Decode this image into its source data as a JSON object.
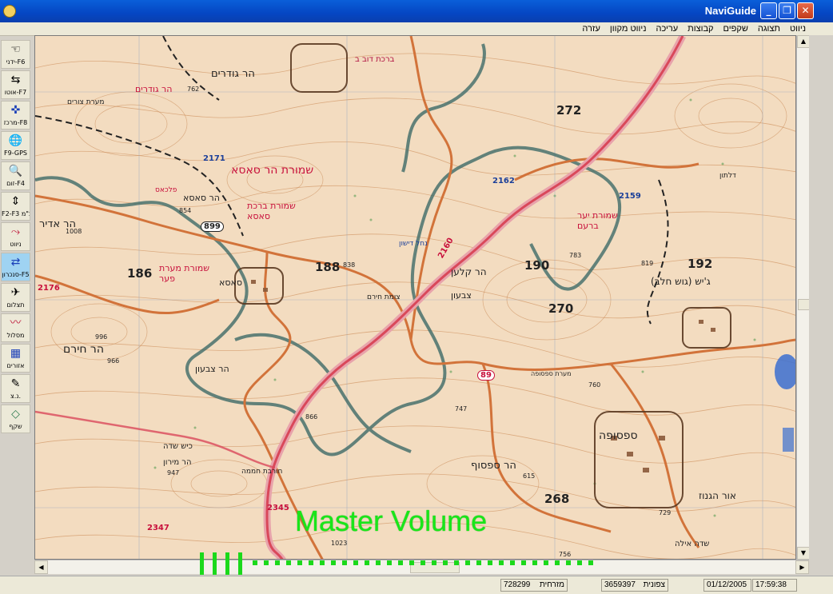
{
  "window": {
    "title": "NaviGuide",
    "minimize": "_",
    "maximize": "❐",
    "close": "✕"
  },
  "menu": [
    "ניווט",
    "תצוגה",
    "שקפים",
    "קבוצות",
    "עריכה",
    "ניווט מקוון",
    "עזרה"
  ],
  "toolbar": [
    {
      "label": "ידני-F6",
      "icon": "hand-pointer-icon",
      "glyph": "☜"
    },
    {
      "label": "אוטו-F7",
      "icon": "auto-navigate-icon",
      "glyph": "⇆"
    },
    {
      "label": "מרכז-F8",
      "icon": "center-crosshair-icon",
      "glyph": "✜"
    },
    {
      "label": "F9-GPS",
      "icon": "globe-icon",
      "glyph": "🌐"
    },
    {
      "label": "זום-F4",
      "icon": "zoom-magnifier-icon",
      "glyph": "🔍"
    },
    {
      "label": "F2-F3 קנ\"מ",
      "icon": "scale-icon",
      "glyph": "⇕"
    },
    {
      "label": "ניווט",
      "icon": "route-icon",
      "glyph": "⤳"
    },
    {
      "label": "סנכרון-F5",
      "icon": "sync-icon",
      "glyph": "⇄"
    },
    {
      "label": "תצלום",
      "icon": "aerial-photo-icon",
      "glyph": "✈"
    },
    {
      "label": "מסלול",
      "icon": "track-icon",
      "glyph": "〰"
    },
    {
      "label": "אזורים",
      "icon": "areas-icon",
      "glyph": "▦"
    },
    {
      "label": "נ.צ.",
      "icon": "coordinate-pin-icon",
      "glyph": "✎"
    },
    {
      "label": "שקף",
      "icon": "layer-icon",
      "glyph": "◇"
    }
  ],
  "map": {
    "labels": [
      "ברכת דוב ב",
      "הר גודרים",
      "הר גודרים",
      "מערת צורים",
      "שמורת הר סאסא",
      "פלכאס",
      "הר סאסא",
      "שמורת ברכת סאסא",
      "הר אדיר",
      "שמורת מערת פער",
      "סאסא",
      "צומת חירם",
      "הר קלען",
      "צבעון",
      "שמורת יער ברעם",
      "ג'יש (גוש חלב)",
      "הר חירם",
      "הר צבעון",
      "כיש שדה",
      "הר מירון",
      "חורבת חממה",
      "הר ספסוף",
      "ספסופה",
      "אור הגנוז",
      "שדה אילה",
      "דלתון",
      "מערת ספסופה",
      "נחל דישון"
    ],
    "grid_numbers": [
      "272",
      "188",
      "186",
      "190",
      "192",
      "270",
      "268"
    ],
    "road_numbers": [
      "899",
      "89",
      "2160",
      "2171",
      "2176",
      "2345",
      "2347",
      "2159",
      "2162"
    ],
    "heights": [
      "762",
      "854",
      "1008",
      "838",
      "996",
      "966",
      "747",
      "866",
      "947",
      "756",
      "783",
      "615",
      "729",
      "819",
      "760",
      "1023"
    ]
  },
  "osd": {
    "text": "Master Volume",
    "level_ticks": 4,
    "level_fraction": 0.4
  },
  "status": {
    "east_label": "מזרחית",
    "east_value": "728299",
    "north_label": "צפונית",
    "north_value": "3659397",
    "date": "01/12/2005",
    "time": "17:59:38"
  },
  "colors": {
    "titlebar": "#0546c3",
    "osd": "#1bd91b",
    "map_bg": "#f3dcc0",
    "contour": "#c98a57",
    "road_main": "#d9485a",
    "boundary": "#3e6b68"
  }
}
